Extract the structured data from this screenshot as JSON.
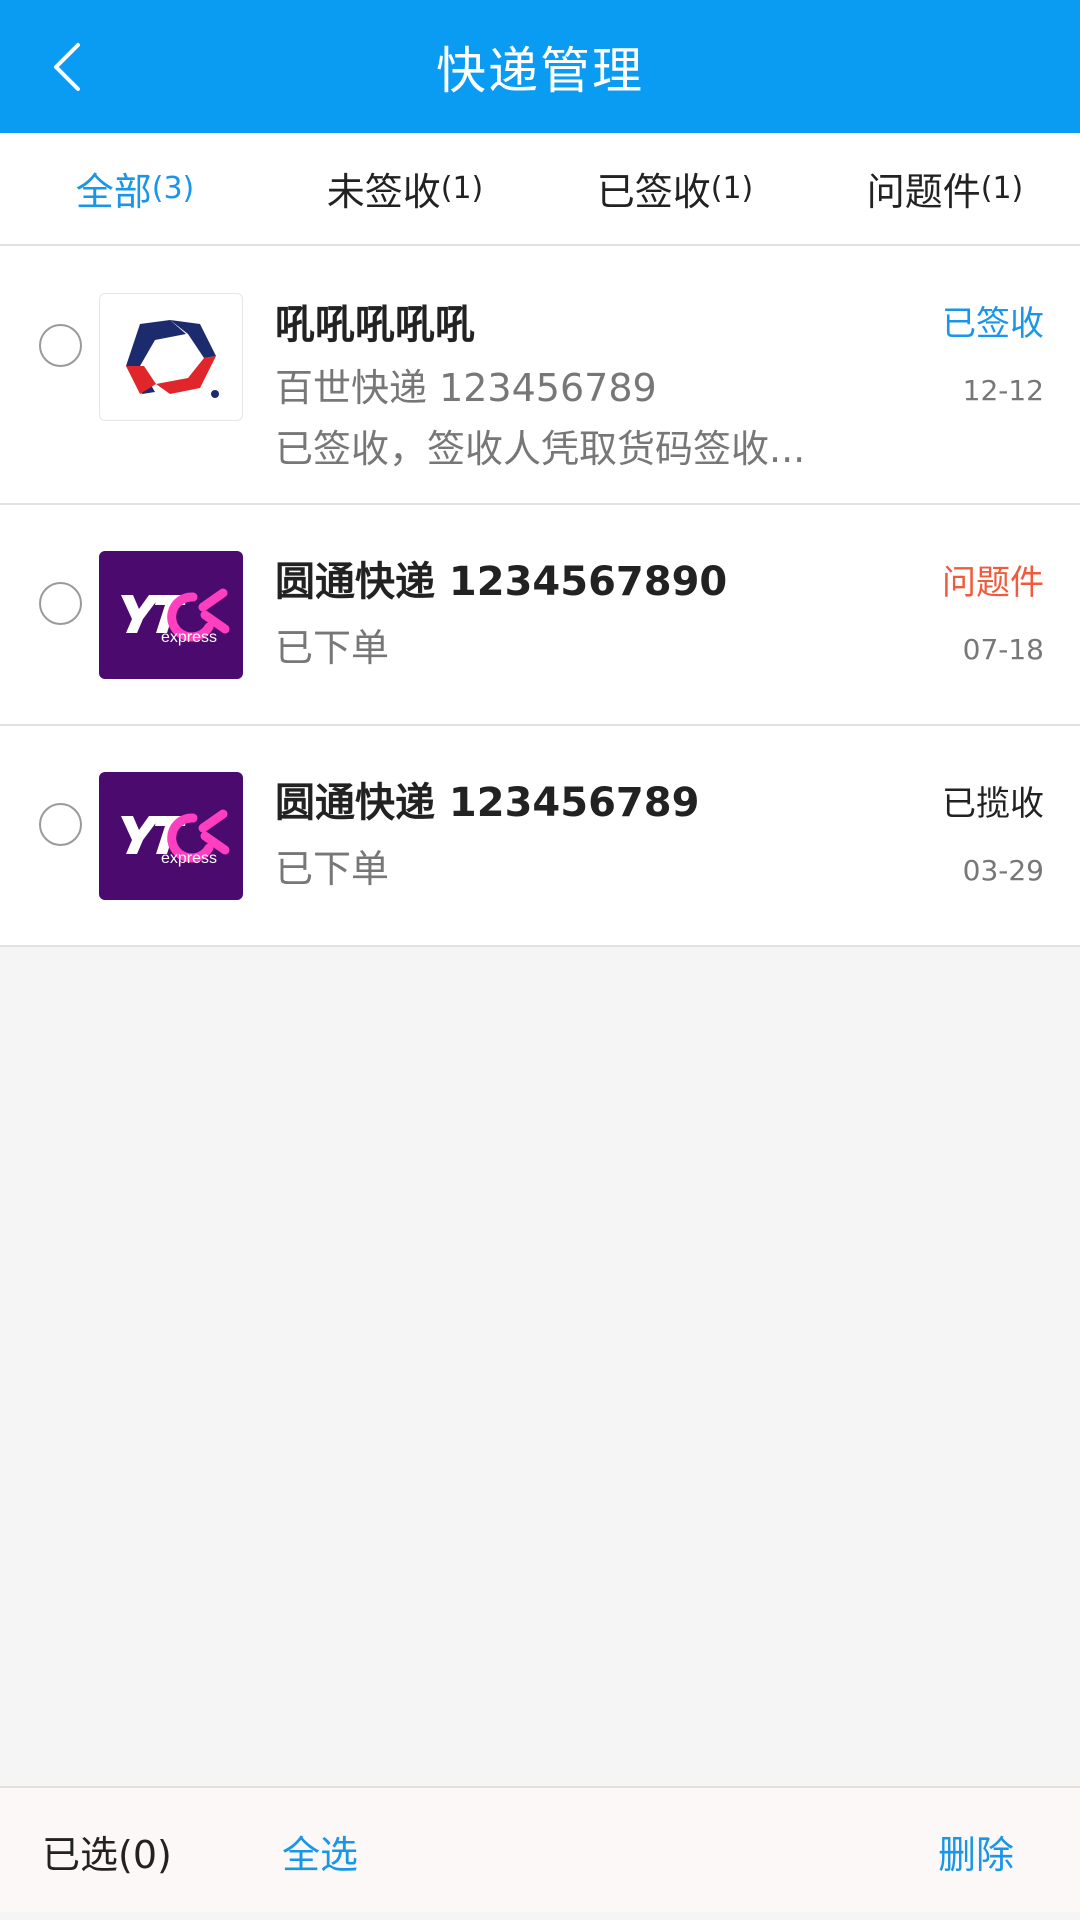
{
  "header": {
    "title": "快递管理",
    "color": "#0a9cf3"
  },
  "tabs": [
    {
      "label": "全部",
      "count": "(3)",
      "active": true
    },
    {
      "label": "未签收",
      "count": "(1)",
      "active": false
    },
    {
      "label": "已签收",
      "count": "(1)",
      "active": false
    },
    {
      "label": "问题件",
      "count": "(1)",
      "active": false
    }
  ],
  "packages": [
    {
      "logo": "best-express-logo",
      "title": "吼吼吼吼吼",
      "line1": "百世快递 123456789",
      "line2": "已签收，签收人凭取货码签收...",
      "status": "已签收",
      "status_color": "#1a96e8",
      "date": "12-12"
    },
    {
      "logo": "yto-express-logo",
      "logo_text": "express",
      "title": "圆通快递 1234567890",
      "line1": "已下单",
      "status": "问题件",
      "status_color": "#ef5b3c",
      "date": "07-18"
    },
    {
      "logo": "yto-express-logo",
      "logo_text": "express",
      "title": "圆通快递 123456789",
      "line1": "已下单",
      "status": "已揽收",
      "status_color": "#222222",
      "date": "03-29"
    }
  ],
  "bottom": {
    "selected": "已选(0)",
    "select_all": "全选",
    "delete": "删除"
  }
}
